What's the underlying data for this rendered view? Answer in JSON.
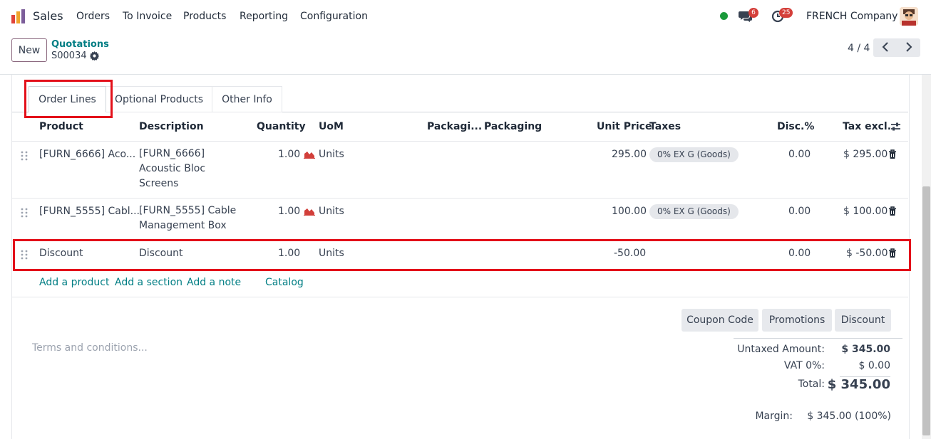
{
  "nav": {
    "app_name": "Sales",
    "menu": [
      "Orders",
      "To Invoice",
      "Products",
      "Reporting",
      "Configuration"
    ],
    "messages_count": "6",
    "activities_count": "25",
    "company": "FRENCH Company",
    "status_color": "#1a9a3a"
  },
  "control_panel": {
    "new_button": "New",
    "breadcrumb_parent": "Quotations",
    "breadcrumb_current": "S00034",
    "pager": "4 / 4"
  },
  "tabs": [
    "Order Lines",
    "Optional Products",
    "Other Info"
  ],
  "table": {
    "columns": [
      "Product",
      "Description",
      "Quantity",
      "UoM",
      "Packagi...",
      "Packaging",
      "Unit Price",
      "Taxes",
      "Disc.%",
      "Tax excl."
    ],
    "rows": [
      {
        "product": "[FURN_6666] Aco...",
        "description": [
          "[FURN_6666]",
          "Acoustic Bloc",
          "Screens"
        ],
        "quantity": "1.00",
        "uom": "Units",
        "unit_price": "295.00",
        "tax": "0% EX G (Goods)",
        "discount": "0.00",
        "subtotal": "$ 295.00"
      },
      {
        "product": "[FURN_5555] Cabl...",
        "description": [
          "[FURN_5555] Cable",
          "Management Box"
        ],
        "quantity": "1.00",
        "uom": "Units",
        "unit_price": "100.00",
        "tax": "0% EX G (Goods)",
        "discount": "0.00",
        "subtotal": "$ 100.00"
      },
      {
        "product": "Discount",
        "description": [
          "Discount"
        ],
        "quantity": "1.00",
        "uom": "Units",
        "unit_price": "-50.00",
        "tax": "",
        "discount": "0.00",
        "subtotal": "$ -50.00"
      }
    ],
    "add_links": [
      "Add a product",
      "Add a section",
      "Add a note",
      "Catalog"
    ]
  },
  "actions": [
    "Coupon Code",
    "Promotions",
    "Discount"
  ],
  "terms_placeholder": "Terms and conditions...",
  "totals": {
    "untaxed_label": "Untaxed Amount:",
    "untaxed_value": "$ 345.00",
    "vat_label": "VAT 0%:",
    "vat_value": "$ 0.00",
    "total_label": "Total:",
    "total_value": "$ 345.00",
    "margin_label": "Margin:",
    "margin_value": "$ 345.00 (100%)"
  },
  "colors": {
    "accent": "#017e84",
    "highlight": "#e3101a",
    "badge": "#d43f3a"
  }
}
